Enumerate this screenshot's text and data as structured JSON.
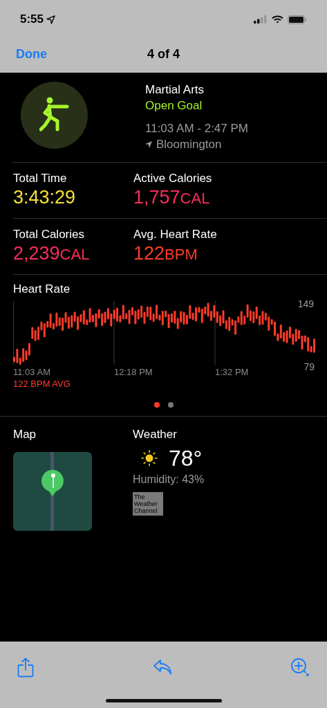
{
  "status_bar": {
    "time": "5:55"
  },
  "nav": {
    "done": "Done",
    "title": "4 of 4"
  },
  "workout": {
    "name": "Martial Arts",
    "goal": "Open Goal",
    "time_range": "11:03 AM - 2:47 PM",
    "location": "Bloomington"
  },
  "metrics": [
    {
      "label": "Total Time",
      "value": "3:43:29",
      "color": "#f4e03a"
    },
    {
      "label": "Active Calories",
      "value": "1,757",
      "unit": "CAL",
      "color": "#fa2d5a"
    },
    {
      "label": "Total Calories",
      "value": "2,239",
      "unit": "CAL",
      "color": "#fa2d5a"
    },
    {
      "label": "Avg. Heart Rate",
      "value": "122",
      "unit": "BPM",
      "color": "#ff3b2a"
    }
  ],
  "heart_rate": {
    "title": "Heart Rate",
    "max_label": "149",
    "min_label": "79",
    "time_labels": [
      "11:03 AM",
      "12:18 PM",
      "1:32 PM"
    ],
    "average": "122 BPM AVG"
  },
  "page_dots": [
    {
      "selected": true
    },
    {
      "selected": false
    }
  ],
  "map": {
    "title": "Map"
  },
  "weather": {
    "title": "Weather",
    "temperature": "78°",
    "humidity": "Humidity: 43%",
    "provider": "The Weather Channel"
  }
}
